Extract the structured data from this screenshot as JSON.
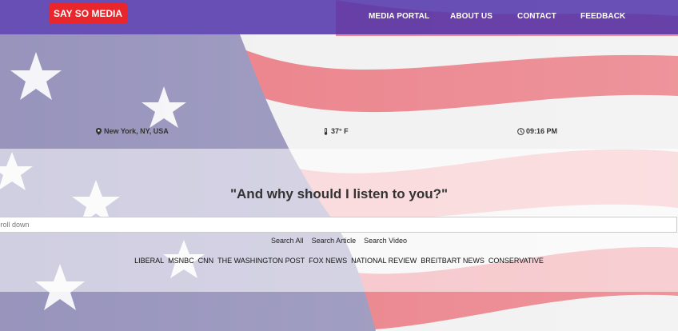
{
  "navbar": {
    "brand": "SAY SO MEDIA",
    "links": [
      "MEDIA PORTAL",
      "ABOUT US",
      "CONTACT",
      "FEEDBACK"
    ]
  },
  "info": {
    "location": "New York, NY, USA",
    "temperature": "37° F",
    "time": "09:16 PM"
  },
  "main": {
    "headline": "\"And why should I listen to you?\"",
    "search_placeholder": "Scroll down",
    "search_options": [
      "Search All",
      "Search Article",
      "Search Video"
    ],
    "sources": [
      "LIBERAL",
      "MSNBC",
      "CNN",
      "THE WASHINGTON POST",
      "FOX NEWS",
      "NATIONAL REVIEW",
      "BREITBART NEWS",
      "CONSERVATIVE"
    ]
  },
  "colors": {
    "navbar": "#5032aa",
    "brand": "#e8262b",
    "flag_blue": "#8c88b5",
    "flag_red": "#e8707a"
  },
  "icons": [
    "map-marker-icon",
    "thermometer-icon",
    "clock-icon"
  ]
}
